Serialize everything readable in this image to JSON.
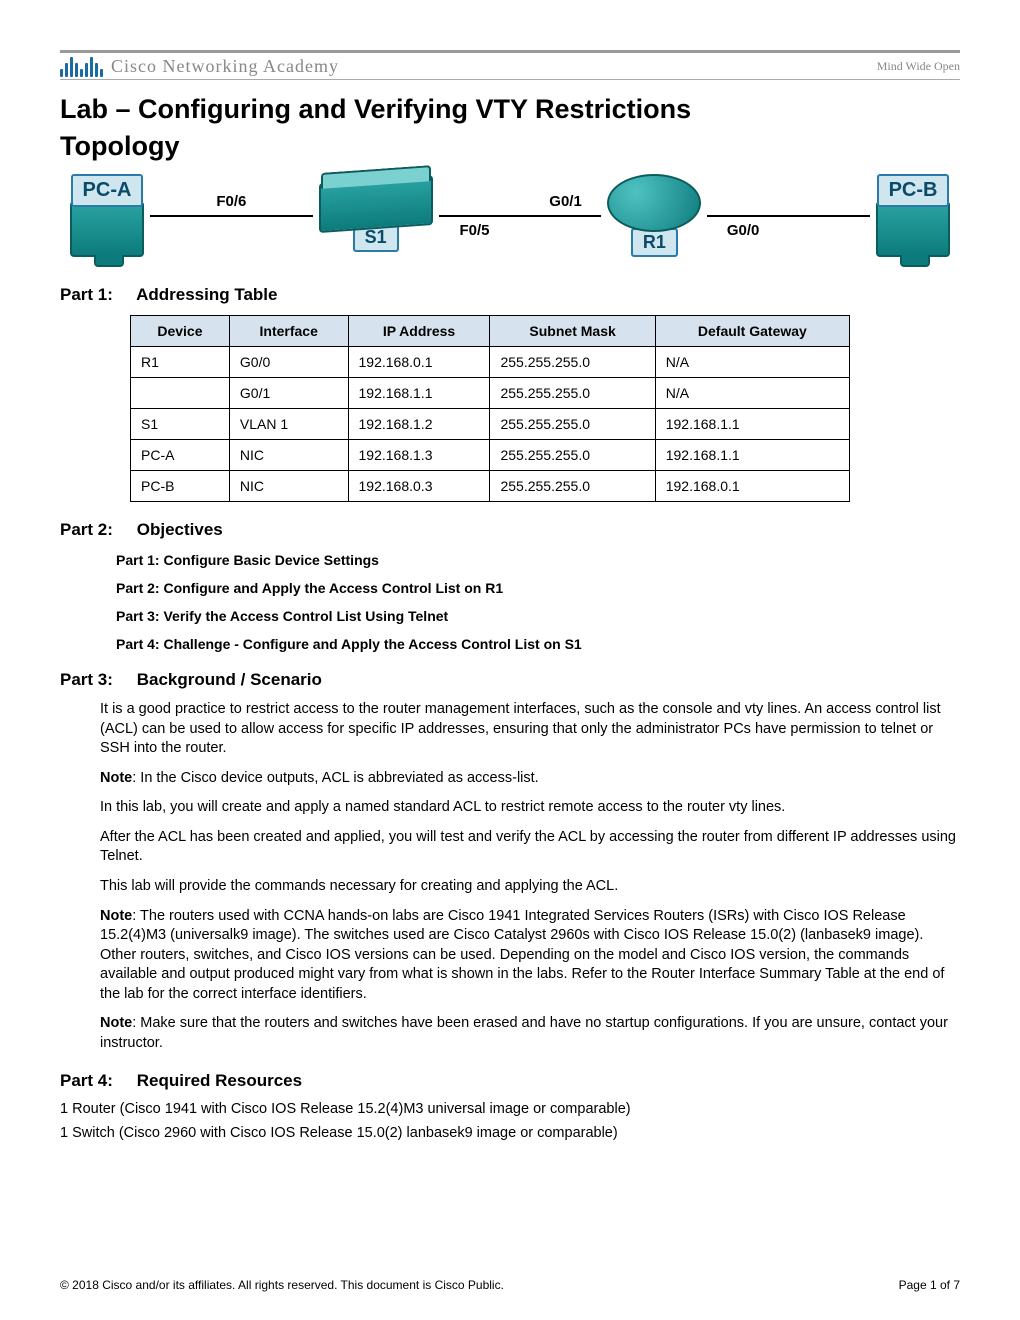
{
  "header": {
    "brand": "CISCO",
    "academy": "Cisco Networking Academy",
    "tagline": "Mind Wide Open"
  },
  "title": "Lab – Configuring and Verifying VTY Restrictions",
  "topology_heading": "Topology",
  "topology": {
    "pc_a": "PC-A",
    "pc_b": "PC-B",
    "s1": "S1",
    "r1": "R1",
    "if_f06": "F0/6",
    "if_f05": "F0/5",
    "if_g01": "G0/1",
    "if_g00": "G0/0"
  },
  "part1": {
    "label": "Part 1:",
    "title": "Addressing Table",
    "headers": [
      "Device",
      "Interface",
      "IP Address",
      "Subnet Mask",
      "Default Gateway"
    ],
    "rows": [
      [
        "R1",
        "G0/0",
        "192.168.0.1",
        "255.255.255.0",
        "N/A"
      ],
      [
        "",
        "G0/1",
        "192.168.1.1",
        "255.255.255.0",
        "N/A"
      ],
      [
        "S1",
        "VLAN 1",
        "192.168.1.2",
        "255.255.255.0",
        "192.168.1.1"
      ],
      [
        "PC-A",
        "NIC",
        "192.168.1.3",
        "255.255.255.0",
        "192.168.1.1"
      ],
      [
        "PC-B",
        "NIC",
        "192.168.0.3",
        "255.255.255.0",
        "192.168.0.1"
      ]
    ]
  },
  "part2": {
    "label": "Part 2:",
    "title": "Objectives",
    "items": [
      "Part 1: Configure Basic Device Settings",
      "Part 2: Configure and Apply the Access Control List on R1",
      "Part 3: Verify the Access Control List Using Telnet",
      "Part 4: Challenge - Configure and Apply the Access Control List on S1"
    ]
  },
  "part3": {
    "label": "Part 3:",
    "title": "Background / Scenario",
    "p1": "It is a good practice to restrict access to the router management interfaces, such as the console and vty lines. An access control list (ACL) can be used to allow access for specific IP addresses, ensuring that only the administrator PCs have permission to telnet or SSH into the router.",
    "note1_label": "Note",
    "note1": ": In the Cisco device outputs, ACL is abbreviated as access-list.",
    "p2": "In this lab, you will create and apply a named standard ACL to restrict remote access to the router vty lines.",
    "p3": "After the ACL has been created and applied, you will test and verify the ACL by accessing the router from different IP addresses using Telnet.",
    "p4": "This lab will provide the commands necessary for creating and applying the ACL.",
    "note2_label": "Note",
    "note2": ": The routers used with CCNA hands-on labs are Cisco 1941 Integrated Services Routers (ISRs) with Cisco IOS Release 15.2(4)M3 (universalk9 image). The switches used are Cisco Catalyst 2960s with Cisco IOS Release 15.0(2) (lanbasek9 image). Other routers, switches, and Cisco IOS versions can be used. Depending on the model and Cisco IOS version, the commands available and output produced might vary from what is shown in the labs. Refer to the Router Interface Summary Table at the end of the lab for the correct interface identifiers.",
    "note3_label": "Note",
    "note3": ": Make sure that the routers and switches have been erased and have no startup configurations. If you are unsure, contact your instructor."
  },
  "part4": {
    "label": "Part 4:",
    "title": "Required Resources",
    "items": [
      "1 Router (Cisco 1941 with Cisco IOS Release 15.2(4)M3 universal image or comparable)",
      "1 Switch (Cisco 2960 with Cisco IOS Release 15.0(2) lanbasek9 image or comparable)"
    ]
  },
  "footer": {
    "copyright": "© 2018 Cisco and/or its affiliates. All rights reserved. This document is Cisco Public.",
    "page": "Page 1 of 7"
  }
}
